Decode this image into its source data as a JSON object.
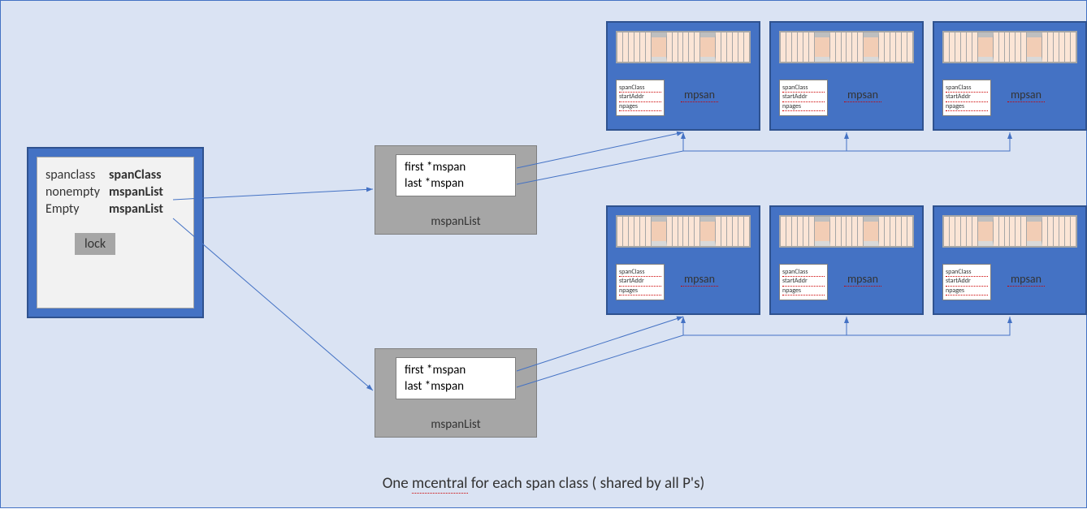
{
  "mcentral": {
    "rows": [
      {
        "key": "spanclass",
        "val": "spanClass"
      },
      {
        "key": "nonempty",
        "val": "mspanList"
      },
      {
        "key": "Empty",
        "val": "mspanList"
      }
    ],
    "lock_label": "lock"
  },
  "mspanlist": {
    "line1": "first *mspan",
    "line2": "last *mspan",
    "label": "mspanList"
  },
  "mspan": {
    "meta1": "spanClass",
    "meta2": "startAddr",
    "meta3": "npages",
    "label": "mpsan"
  },
  "caption_parts": {
    "p1": "One ",
    "p2": "mcentral",
    "p3": " for each span class ( shared by all P's)"
  }
}
